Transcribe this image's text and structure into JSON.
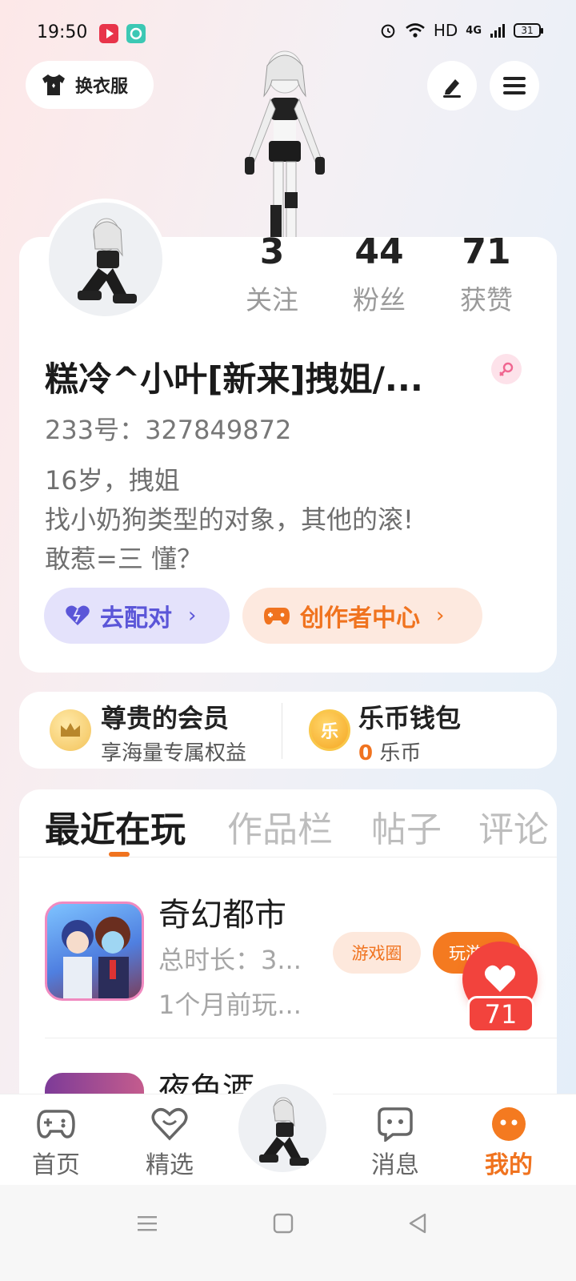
{
  "status_bar": {
    "time": "19:50",
    "network": "HD",
    "signal": "4G",
    "battery": "31"
  },
  "top": {
    "outfit_label": "换衣服",
    "edit_icon": "pen-icon",
    "menu_icon": "menu-icon"
  },
  "profile": {
    "stats": [
      {
        "value": "3",
        "label": "关注"
      },
      {
        "value": "44",
        "label": "粉丝"
      },
      {
        "value": "71",
        "label": "获赞"
      }
    ],
    "username": "糕冷^小叶[新来]拽姐/...",
    "uid": "233号：327849872",
    "bio_lines": [
      "16岁，拽姐",
      "找小奶狗类型的对象，其他的滚!",
      "敢惹=三 懂？"
    ],
    "pair_label": "去配对",
    "creator_label": "创作者中心"
  },
  "benefits": {
    "vip_title": "尊贵的会员",
    "vip_sub": "享海量专属权益",
    "wallet_title": "乐币钱包",
    "wallet_amount": "0",
    "wallet_unit": "乐币",
    "coin_glyph": "乐"
  },
  "tabs": [
    "最近在玩",
    "作品栏",
    "帖子",
    "评论"
  ],
  "recent_games": [
    {
      "title": "奇幻都市",
      "duration": "总时长：3...",
      "last_played": "1个月前玩...",
      "circle_label": "游戏圈",
      "play_label": "玩游"
    },
    {
      "title": "夜色酒"
    }
  ],
  "like_float": {
    "count": "71"
  },
  "bottom_nav": [
    {
      "label": "首页",
      "icon": "gamepad-icon"
    },
    {
      "label": "精选",
      "icon": "heart-badge-icon"
    },
    {
      "label": "",
      "icon": "avatar"
    },
    {
      "label": "消息",
      "icon": "chat-icon"
    },
    {
      "label": "我的",
      "icon": "profile-icon"
    }
  ],
  "colors": {
    "accent": "#f0731f",
    "pair_text": "#5b56d8",
    "like_red": "#f2433d"
  }
}
